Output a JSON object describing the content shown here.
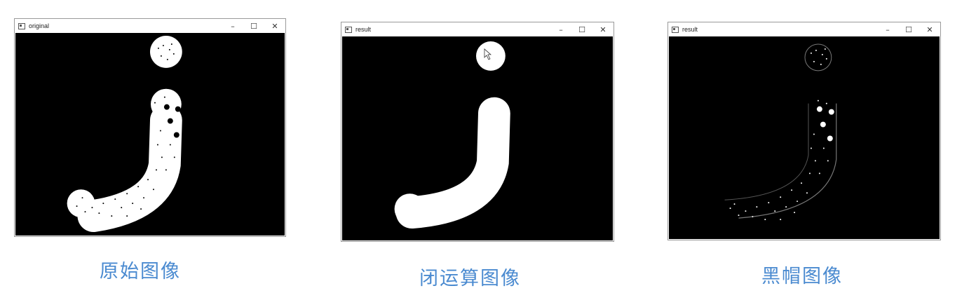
{
  "windows": [
    {
      "title": "original",
      "minimize": "–",
      "maximize": "☐",
      "close": "✕"
    },
    {
      "title": "result",
      "minimize": "–",
      "maximize": "☐",
      "close": "✕"
    },
    {
      "title": "result",
      "minimize": "–",
      "maximize": "☐",
      "close": "✕"
    }
  ],
  "captions": [
    "原始图像",
    "闭运算图像",
    "黑帽图像"
  ],
  "icons": {
    "app": "opencv-window-icon",
    "minimize": "minimize-icon",
    "maximize": "maximize-icon",
    "close": "close-icon",
    "cursor": "mouse-pointer-icon"
  }
}
